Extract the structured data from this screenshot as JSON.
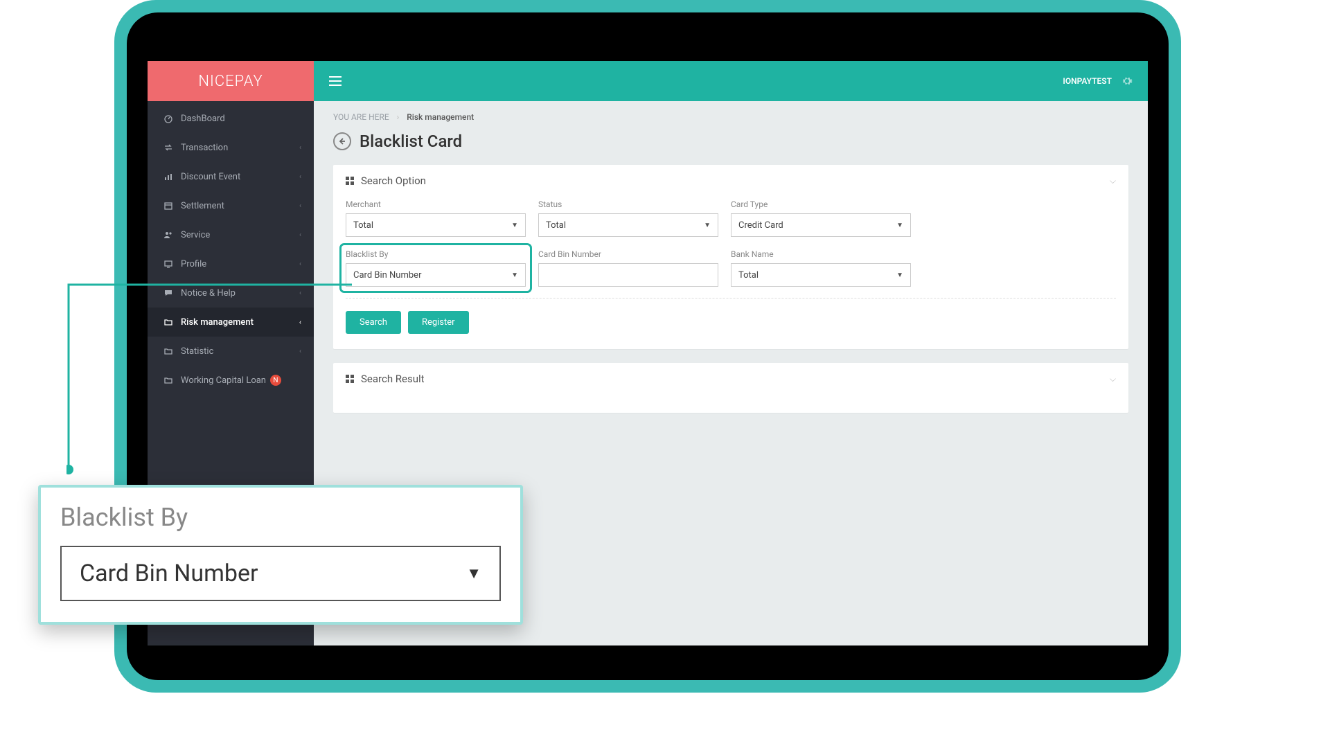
{
  "brand": "NICEPAY",
  "user": "IONPAYTEST",
  "breadcrumb": {
    "prefix": "YOU ARE HERE",
    "current": "Risk management"
  },
  "page_title": "Blacklist Card",
  "sidebar": {
    "items": [
      {
        "label": "DashBoard",
        "icon": "dashboard",
        "expandable": false
      },
      {
        "label": "Transaction",
        "icon": "transaction",
        "expandable": true
      },
      {
        "label": "Discount Event",
        "icon": "chart",
        "expandable": true
      },
      {
        "label": "Settlement",
        "icon": "calendar",
        "expandable": true
      },
      {
        "label": "Service",
        "icon": "users",
        "expandable": true
      },
      {
        "label": "Profile",
        "icon": "monitor",
        "expandable": true
      },
      {
        "label": "Notice & Help",
        "icon": "chat",
        "expandable": true
      },
      {
        "label": "Risk management",
        "icon": "folder",
        "expandable": true,
        "active": true
      },
      {
        "label": "Statistic",
        "icon": "folder",
        "expandable": true
      },
      {
        "label": "Working Capital Loan",
        "icon": "folder",
        "expandable": false,
        "badge": "N"
      }
    ]
  },
  "panels": {
    "search_option": {
      "title": "Search Option"
    },
    "search_result": {
      "title": "Search Result"
    }
  },
  "form": {
    "merchant": {
      "label": "Merchant",
      "value": "Total"
    },
    "status": {
      "label": "Status",
      "value": "Total"
    },
    "card_type": {
      "label": "Card Type",
      "value": "Credit Card"
    },
    "blacklist_by": {
      "label": "Blacklist By",
      "value": "Card Bin Number"
    },
    "card_bin": {
      "label": "Card Bin Number",
      "value": ""
    },
    "bank_name": {
      "label": "Bank Name",
      "value": "Total"
    }
  },
  "buttons": {
    "search": "Search",
    "register": "Register"
  },
  "callout": {
    "label": "Blacklist By",
    "value": "Card Bin Number"
  }
}
